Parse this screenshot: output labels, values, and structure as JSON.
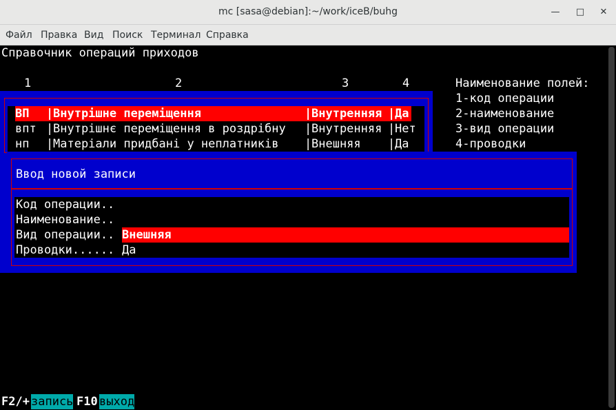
{
  "window": {
    "title": "mc [sasa@debian]:~/work/iceB/buhg",
    "minimize_icon": "minimize-icon",
    "maximize_icon": "maximize-icon",
    "close_icon": "close-icon"
  },
  "menu": [
    "Файл",
    "Правка",
    "Вид",
    "Поиск",
    "Терминал",
    "Справка"
  ],
  "screen": {
    "heading": "Справочник операций приходов",
    "column_numbers": [
      "1",
      "2",
      "3",
      "4"
    ],
    "rows": [
      {
        "code": "ВП",
        "name": "Внутрішне переміщення",
        "type": "Внутренняя",
        "post": "Да"
      },
      {
        "code": "впт",
        "name": "Внутрішнє переміщення в роздрібну",
        "type": "Внутренняя",
        "post": "Нет"
      },
      {
        "code": "нп",
        "name": "Матеріали придбані у неплатників",
        "type": "Внешняя",
        "post": "Да"
      }
    ],
    "legend": {
      "title": "Наименование полей:",
      "items": [
        "1-код операции",
        "2-наименование",
        "3-вид операции",
        "4-проводки"
      ]
    }
  },
  "dialog": {
    "title": "Ввод новой записи",
    "fields": [
      {
        "label": "Код операции..",
        "value": ""
      },
      {
        "label": "Наименование..",
        "value": ""
      },
      {
        "label": "Вид операции..",
        "value": "Внешняя"
      },
      {
        "label": "Проводки......",
        "value": "Да"
      }
    ]
  },
  "footer": {
    "keys": [
      {
        "key": "F2/+",
        "label": "запись"
      },
      {
        "key": "F10",
        "label": "выход"
      }
    ]
  },
  "colors": {
    "panel_blue": "#0000cd",
    "dialog_border_red": "#d40000",
    "highlight_red": "#ff0000",
    "fkey_cyan": "#00aaaa"
  }
}
